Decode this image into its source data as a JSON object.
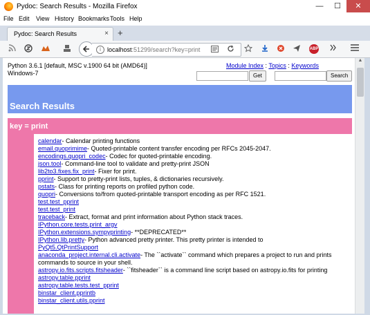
{
  "window": {
    "title": "Pydoc: Search Results - Mozilla Firefox",
    "min": "—",
    "max": "☐",
    "close": "✕"
  },
  "menu": [
    "File",
    "Edit",
    "View",
    "History",
    "Bookmarks",
    "Tools",
    "Help"
  ],
  "tab": {
    "label": "Pydoc: Search Results",
    "close": "×",
    "new": "+"
  },
  "url": {
    "host": "localhost",
    "path": ":51299/search?key=print"
  },
  "page": {
    "python_line1": "Python 3.6.1 [default, MSC v.1900 64 bit (AMD64)]",
    "python_line2": "Windows-7",
    "links": {
      "module_index": "Module Index",
      "sep1": " : ",
      "topics": "Topics",
      "sep2": " : ",
      "keywords": "Keywords"
    },
    "get_button": "Get",
    "search_button": "Search",
    "results_heading": "Search Results",
    "key_heading": "key = print",
    "results": [
      {
        "link": "calendar",
        "desc": "- Calendar printing functions"
      },
      {
        "link": "email.quoprimime",
        "desc": "- Quoted-printable content transfer encoding per RFCs 2045-2047."
      },
      {
        "link": "encodings.quopri_codec",
        "desc": "- Codec for quoted-printable encoding."
      },
      {
        "link": "json.tool",
        "desc": "- Command-line tool to validate and pretty-print JSON"
      },
      {
        "link": "lib2to3.fixes.fix_print",
        "desc": "- Fixer for print."
      },
      {
        "link": "pprint",
        "desc": "- Support to pretty-print lists, tuples, & dictionaries recursively."
      },
      {
        "link": "pstats",
        "desc": "- Class for printing reports on profiled python code."
      },
      {
        "link": "quopri",
        "desc": "- Conversions to/from quoted-printable transport encoding as per RFC 1521."
      },
      {
        "link": "test.test_pprint",
        "desc": ""
      },
      {
        "link": "test.test_print",
        "desc": ""
      },
      {
        "link": "traceback",
        "desc": "- Extract, format and print information about Python stack traces."
      },
      {
        "link": "IPython.core.tests.print_argv",
        "desc": ""
      },
      {
        "link": "IPython.extensions.sympyprinting",
        "desc": "- **DEPRECATED**"
      },
      {
        "link": "IPython.lib.pretty",
        "desc": "- Python advanced pretty printer. This pretty printer is intended to"
      },
      {
        "link": "PyQt5.QtPrintSupport",
        "desc": ""
      },
      {
        "link": "anaconda_project.internal.cli.activate",
        "desc": "- The ``activate`` command which prepares a project to run and prints commands to source in your shell."
      },
      {
        "link": "astropy.io.fits.scripts.fitsheader",
        "desc": "- ``fitsheader`` is a command line script based on astropy.io.fits for printing"
      },
      {
        "link": "astropy.table.pprint",
        "desc": ""
      },
      {
        "link": "astropy.table.tests.test_pprint",
        "desc": ""
      },
      {
        "link": "binstar_client.pprintb",
        "desc": ""
      },
      {
        "link": "binstar_client.utils.pprint",
        "desc": ""
      }
    ]
  }
}
